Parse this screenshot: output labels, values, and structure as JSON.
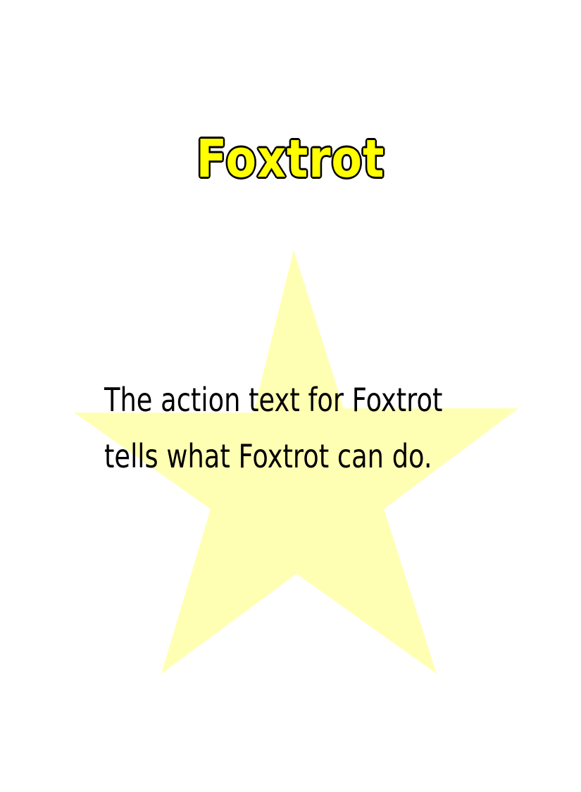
{
  "card": {
    "title": "Foxtrot",
    "action_lines": [
      "The action text for Foxtrot",
      "tells what Foxtrot can do."
    ],
    "art_icon": "star-icon",
    "colors": {
      "title_fill": "#ffff00",
      "title_outline": "#000000",
      "star_fill": "#ffffb3",
      "text": "#000000",
      "background": "#ffffff"
    }
  }
}
